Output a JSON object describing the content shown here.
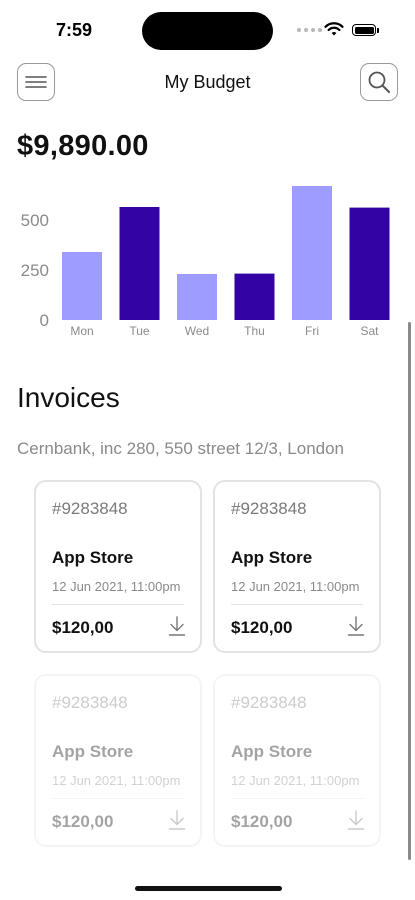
{
  "status_bar": {
    "time": "7:59"
  },
  "header": {
    "title": "My Budget",
    "menu_icon": "menu-icon",
    "search_icon": "search-icon"
  },
  "balance": "$9,890.00",
  "colors": {
    "bar_light": "#9e9cff",
    "bar_dark": "#3303a3",
    "text_muted": "#8a8a8a"
  },
  "chart_data": {
    "type": "bar",
    "categories": [
      "Mon",
      "Tue",
      "Wed",
      "Thu",
      "Fri",
      "Sat"
    ],
    "values": [
      340,
      565,
      230,
      232,
      670,
      562
    ],
    "bar_colors": [
      "#9e9cff",
      "#3303a3",
      "#9e9cff",
      "#3303a3",
      "#9e9cff",
      "#3303a3"
    ],
    "yticks": [
      0,
      250,
      500
    ],
    "ylim": [
      0,
      700
    ],
    "grid": false,
    "legend": "none"
  },
  "invoices": {
    "title": "Invoices",
    "address": "Cernbank, inc 280, 550 street 12/3, London",
    "items": [
      {
        "number": "#9283848",
        "merchant": "App Store",
        "date": "12 Jun 2021, 11:00pm",
        "amount": "$120,00"
      },
      {
        "number": "#9283848",
        "merchant": "App Store",
        "date": "12 Jun 2021, 11:00pm",
        "amount": "$120,00"
      },
      {
        "number": "#9283848",
        "merchant": "App Store",
        "date": "12 Jun 2021, 11:00pm",
        "amount": "$120,00"
      },
      {
        "number": "#9283848",
        "merchant": "App Store",
        "date": "12 Jun 2021, 11:00pm",
        "amount": "$120,00"
      }
    ],
    "download_icon": "download-icon"
  }
}
